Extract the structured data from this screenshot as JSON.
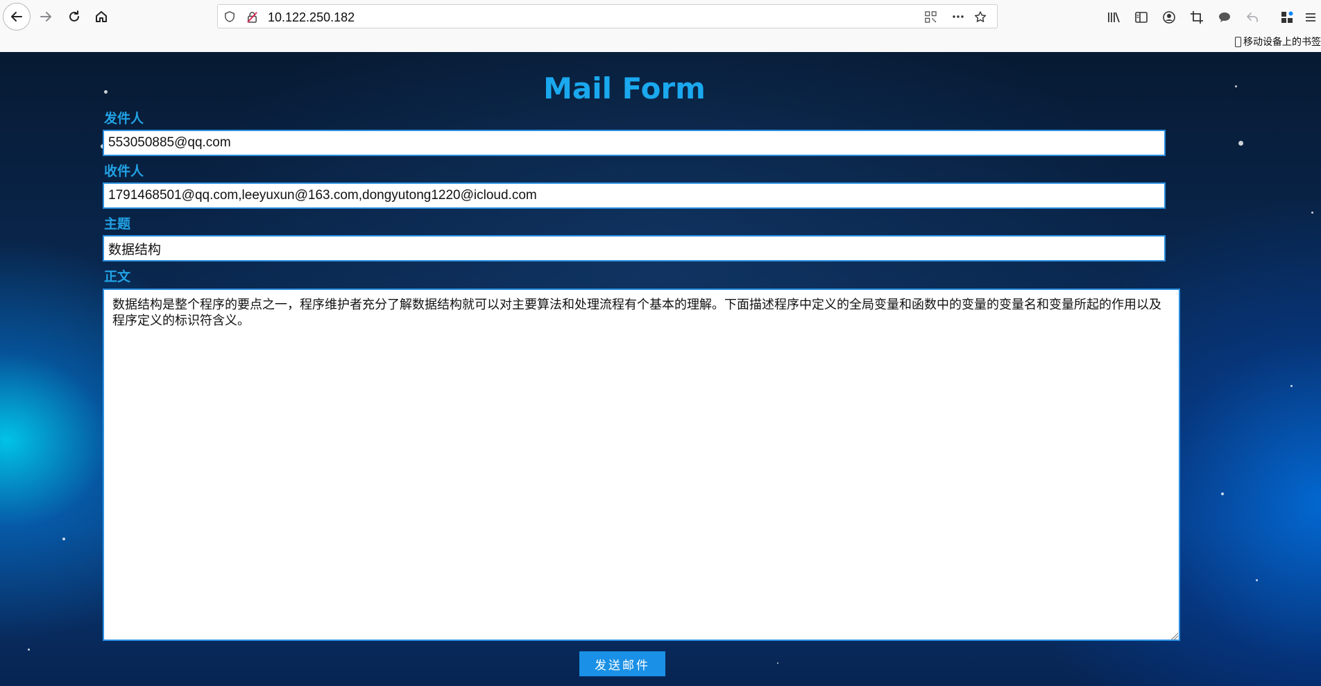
{
  "browser": {
    "url": "10.122.250.182",
    "bookmarks_folder": "移动设备上的书签"
  },
  "form": {
    "title": "Mail Form",
    "sender": {
      "label": "发件人",
      "value": "553050885@qq.com"
    },
    "recipients": {
      "label": "收件人",
      "value": "1791468501@qq.com,leeyuxun@163.com,dongyutong1220@icloud.com"
    },
    "subject": {
      "label": "主题",
      "value": "数据结构"
    },
    "body": {
      "label": "正文",
      "value": "数据结构是整个程序的要点之一，程序维护者充分了解数据结构就可以对主要算法和处理流程有个基本的理解。下面描述程序中定义的全局变量和函数中的变量的变量名和变量所起的作用以及程序定义的标识符含义。"
    },
    "submit_label": "发送邮件"
  },
  "colors": {
    "title": "#1aa8ee",
    "label": "#22a3e6",
    "button": "#1a90e6",
    "field_border": "#2b8fe0"
  },
  "icons": {
    "nav": [
      "back-arrow-icon",
      "forward-arrow-icon",
      "reload-icon",
      "home-icon"
    ],
    "urlbar": [
      "shield-icon",
      "insecure-lock-icon",
      "qr-code-icon",
      "more-dots-icon",
      "star-icon"
    ],
    "toolbar": [
      "library-icon",
      "sidebar-icon",
      "account-icon",
      "screenshot-icon",
      "chat-icon",
      "undo-icon",
      "extensions-icon",
      "menu-icon"
    ]
  }
}
